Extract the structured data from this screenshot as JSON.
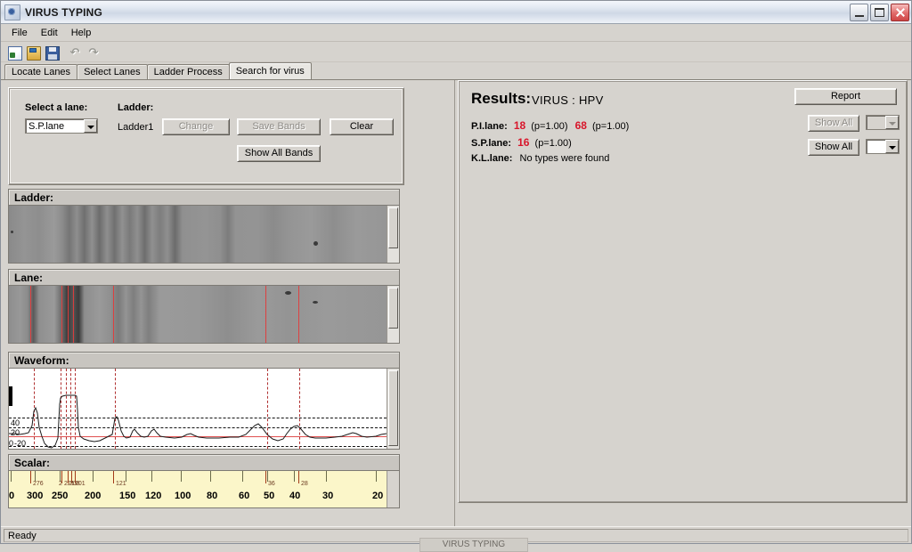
{
  "window": {
    "title": "VIRUS TYPING",
    "icon": "app-icon",
    "minimize_label": "",
    "maximize_label": "",
    "close_label": ""
  },
  "menu": {
    "items": [
      "File",
      "Edit",
      "Help"
    ]
  },
  "toolbar": {
    "buttons": [
      {
        "name": "new-icon",
        "glyph": ""
      },
      {
        "name": "open-icon",
        "glyph": ""
      },
      {
        "name": "save-icon",
        "glyph": ""
      },
      {
        "name": "undo-icon",
        "glyph": "↶"
      },
      {
        "name": "redo-icon",
        "glyph": "↷"
      }
    ]
  },
  "tabs": [
    {
      "label": "Locate Lanes",
      "active": false
    },
    {
      "label": "Select Lanes",
      "active": false
    },
    {
      "label": "Ladder Process",
      "active": false
    },
    {
      "label": "Search for virus",
      "active": true
    }
  ],
  "controls": {
    "select_lane_label": "Select a lane:",
    "lane_value": "S.P.lane",
    "ladder_label": "Ladder:",
    "ladder_value": "Ladder1",
    "change_button": "Change",
    "save_bands_button": "Save Bands",
    "show_all_bands_button": "Show All Bands",
    "clear_button": "Clear"
  },
  "panels": {
    "ladder_title": "Ladder:",
    "lane_title": "Lane:",
    "waveform_title": "Waveform:",
    "scalar_title": "Scalar:"
  },
  "waveform": {
    "y_labels": [
      "40",
      "20",
      "0",
      "-20"
    ]
  },
  "scalar": {
    "major_labels": [
      "0",
      "300",
      "250",
      "200",
      "150",
      "120",
      "100",
      "80",
      "60",
      "50",
      "40",
      "30",
      "20"
    ],
    "band_labels": [
      "276",
      "2",
      "221",
      "208",
      "201",
      "121",
      "36",
      "28"
    ]
  },
  "results": {
    "heading": "Results:",
    "virus": "VIRUS : HPV",
    "report_button": "Report",
    "show_all_button_disabled": "Show All",
    "show_all_button": "Show All",
    "rows": [
      {
        "lane": "P.I.lane:",
        "types": [
          {
            "type": "18",
            "p": "(p=1.00)"
          },
          {
            "type": "68",
            "p": "(p=1.00)"
          }
        ],
        "message": ""
      },
      {
        "lane": "S.P.lane:",
        "types": [
          {
            "type": "16",
            "p": "(p=1.00)"
          }
        ],
        "message": ""
      },
      {
        "lane": "K.L.lane:",
        "types": [],
        "message": "No types were found"
      }
    ]
  },
  "statusbar": {
    "text": "Ready",
    "taskbar_text": "VIRUS TYPING"
  },
  "colors": {
    "accent_red": "#d8152a",
    "marker_red": "#e03c3c",
    "scalar_bg": "#fbf6c9",
    "face": "#d6d3ce"
  }
}
